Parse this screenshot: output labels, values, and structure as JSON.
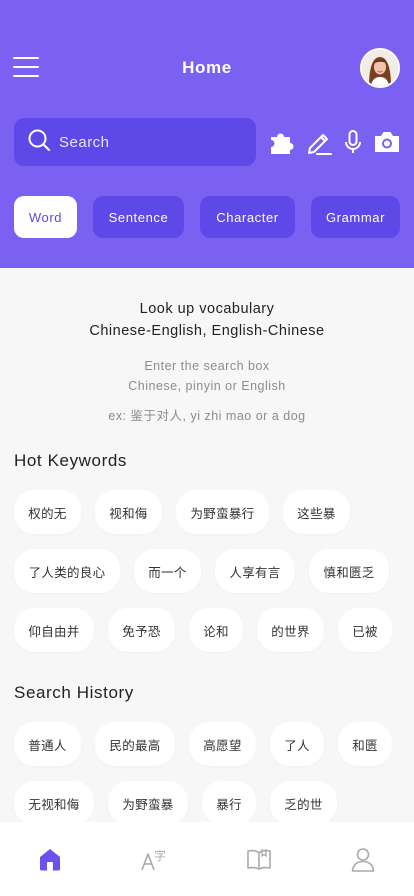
{
  "header": {
    "title": "Home",
    "menu_icon": "hamburger-menu-icon",
    "accent": "#7a61f2",
    "search_bg": "#5f48e8"
  },
  "search": {
    "placeholder": "Search"
  },
  "tools": [
    "puzzle-icon",
    "pencil-icon",
    "microphone-icon",
    "camera-icon"
  ],
  "tabs": [
    {
      "label": "Word",
      "active": true
    },
    {
      "label": "Sentence",
      "active": false
    },
    {
      "label": "Character",
      "active": false
    },
    {
      "label": "Grammar",
      "active": false
    }
  ],
  "lookup": {
    "title_line1": "Look up vocabulary",
    "title_line2": "Chinese-English, English-Chinese",
    "hint_line1": "Enter the search box",
    "hint_line2": "Chinese, pinyin or English",
    "example": "ex: 鉴于对人, yi zhi mao or a dog"
  },
  "hot_keywords": {
    "title": "Hot Keywords",
    "items": [
      "权的无",
      "视和侮",
      "为野蛮暴行",
      "这些暴",
      "了人类的良心",
      "而一个",
      "人享有言",
      "慎和匮乏",
      "仰自由并",
      "免予恐",
      "论和",
      "的世界",
      "已被"
    ]
  },
  "search_history": {
    "title": "Search History",
    "items": [
      "普通人",
      "民的最高",
      "高愿望",
      "了人",
      "和匮",
      "无视和侮",
      "为野蛮暴",
      "暴行",
      "乏的世"
    ]
  },
  "bottom_nav": [
    {
      "icon": "home-icon",
      "active": true
    },
    {
      "icon": "translate-icon",
      "active": false
    },
    {
      "icon": "book-icon",
      "active": false
    },
    {
      "icon": "user-icon",
      "active": false
    }
  ]
}
